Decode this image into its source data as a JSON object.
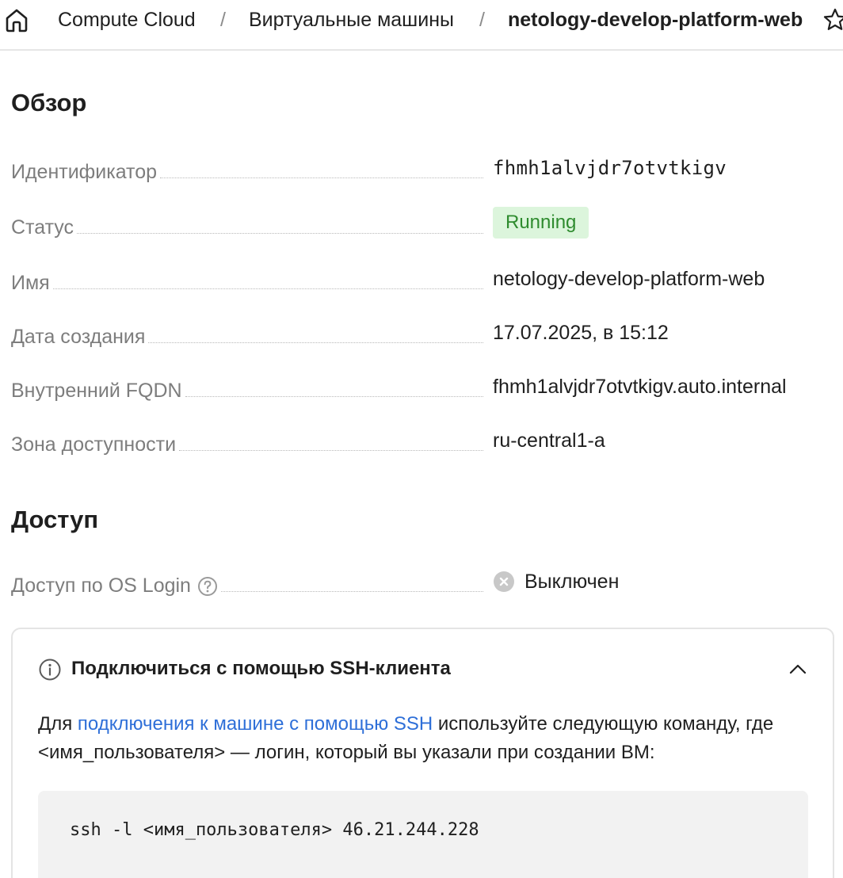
{
  "breadcrumb": {
    "home_icon": "home-icon",
    "items": [
      "Compute Cloud",
      "Виртуальные машины",
      "netology-develop-platform-web"
    ],
    "separator": "/",
    "favorite_icon": "star-icon"
  },
  "overview": {
    "title": "Обзор",
    "rows": {
      "id": {
        "label": "Идентификатор",
        "value": "fhmh1alvjdr7otvtkigv"
      },
      "status": {
        "label": "Статус",
        "value": "Running",
        "color": "#2e8b2e",
        "background": "#dcf5dc"
      },
      "name": {
        "label": "Имя",
        "value": "netology-develop-platform-web"
      },
      "created": {
        "label": "Дата создания",
        "value": "17.07.2025, в 15:12"
      },
      "fqdn": {
        "label": "Внутренний FQDN",
        "value": "fhmh1alvjdr7otvtkigv.auto.internal"
      },
      "zone": {
        "label": "Зона доступности",
        "value": "ru-central1-a"
      }
    }
  },
  "access": {
    "title": "Доступ",
    "os_login": {
      "label": "Доступ по OS Login",
      "help_icon": "question-circle-icon",
      "status_icon": "x-circle-icon",
      "value": "Выключен"
    }
  },
  "ssh": {
    "title": "Подключиться с помощью SSH-клиента",
    "info_icon": "info-circle-icon",
    "collapse_icon": "chevron-up-icon",
    "desc_prefix": "Для ",
    "desc_link": "подключения к машине с помощью SSH",
    "desc_suffix": " используйте следующую команду, где <имя_пользователя> — логин, который вы указали при создании ВМ:",
    "command": "ssh -l <имя_пользователя> 46.21.244.228",
    "link_color": "#2e6fd8"
  }
}
